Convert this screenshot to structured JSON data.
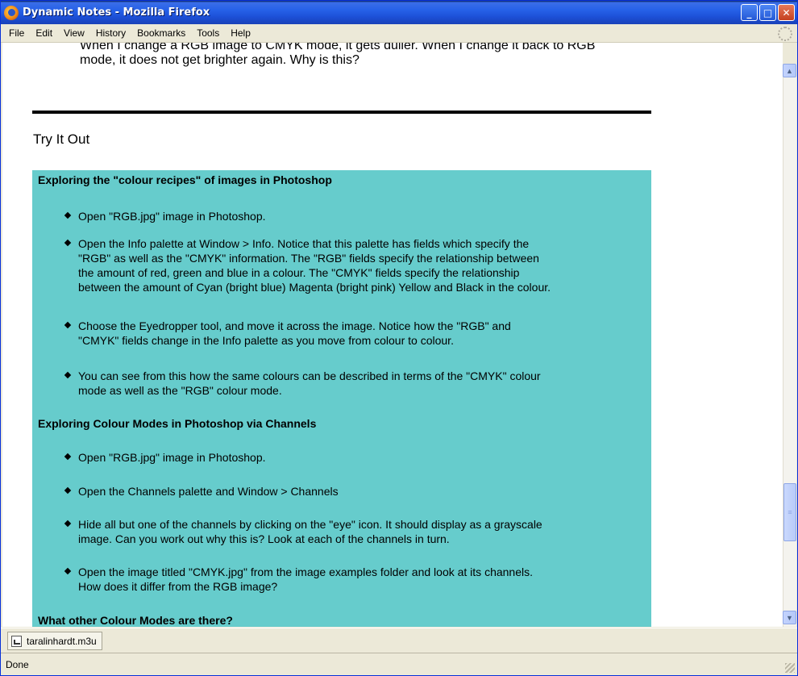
{
  "window": {
    "title": "Dynamic Notes - Mozilla Firefox"
  },
  "menu": [
    "File",
    "Edit",
    "View",
    "History",
    "Bookmarks",
    "Tools",
    "Help"
  ],
  "page": {
    "prev_bullet_line1": "When I change a RGB image to CMYK mode, it gets duller. When I change it back to RGB",
    "prev_bullet_line2": "mode, it does not get brighter again. Why is this?",
    "heading": "Try It Out",
    "sections": [
      {
        "title": "Exploring the \"colour recipes\" of images in Photoshop",
        "items": [
          [
            "Open \"RGB.jpg\" image in Photoshop."
          ],
          [
            "Open the Info palette at Window > Info. Notice that this palette has fields which specify the",
            "\"RGB\" as well as the \"CMYK\" information. The \"RGB\" fields specify the relationship between",
            "the amount of red, green and blue in a colour. The \"CMYK\" fields specify the relationship",
            "between the amount of Cyan (bright blue) Magenta (bright pink) Yellow and Black in the colour."
          ],
          [
            "Choose the Eyedropper tool, and move it across the image. Notice how the \"RGB\" and",
            "\"CMYK\" fields change in the Info palette as you move from colour to colour."
          ],
          [
            "You can see from this how the same colours can be described in terms of the \"CMYK\" colour",
            "mode as well as the \"RGB\" colour mode."
          ]
        ]
      },
      {
        "title": "Exploring Colour Modes in Photoshop via Channels",
        "items": [
          [
            "Open \"RGB.jpg\" image in Photoshop."
          ],
          [
            "Open the Channels palette and Window > Channels"
          ],
          [
            "Hide all but one of the channels by clicking on the \"eye\" icon. It should display as a grayscale",
            "image. Can you work out why this is? Look at each of the channels in turn."
          ],
          [
            "Open the image titled \"CMYK.jpg\" from the image examples folder and look at its channels.",
            "How does it differ from the RGB image?"
          ]
        ]
      },
      {
        "title": "What other Colour Modes are there?",
        "items": []
      }
    ]
  },
  "taskbar": {
    "tab_label": "taralinhardt.m3u"
  },
  "status": {
    "text": "Done"
  },
  "colors": {
    "panel": "#66cccc",
    "titlebar": "#2661e8"
  }
}
